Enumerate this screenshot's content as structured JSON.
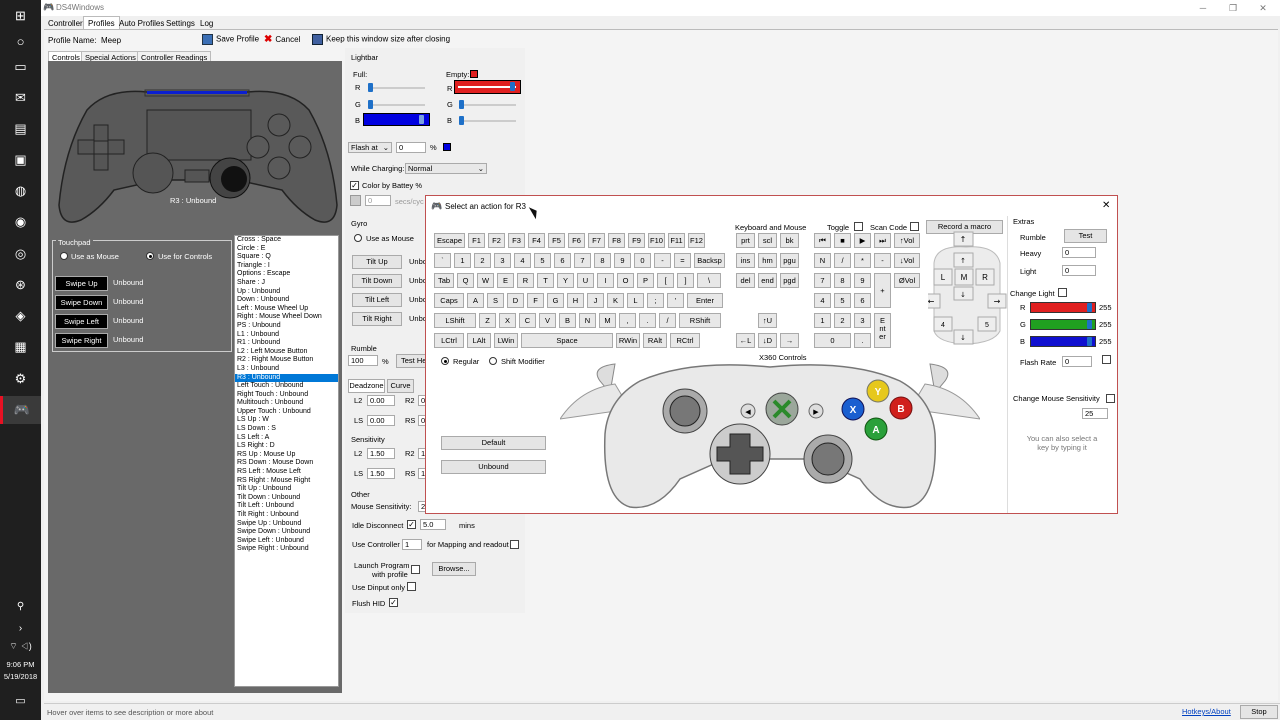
{
  "window": {
    "title": "DS4Windows"
  },
  "menu_tabs": [
    "Controllers",
    "Profiles",
    "Auto Profiles",
    "Settings",
    "Log"
  ],
  "toolbar": {
    "profile_name_label": "Profile Name:",
    "profile_name_value": "Meep",
    "save_label": "Save Profile",
    "cancel_label": "Cancel",
    "keep_size_label": "Keep this window size after closing"
  },
  "sub_tabs": [
    "Controls",
    "Special Actions",
    "Controller Readings"
  ],
  "controller": {
    "r3_caption": "R3 : Unbound"
  },
  "touchpad": {
    "group_label": "Touchpad",
    "use_as_mouse": "Use as Mouse",
    "use_for_controls": "Use for Controls",
    "swipes": [
      {
        "label": "Swipe Up",
        "value": "Unbound"
      },
      {
        "label": "Swipe Down",
        "value": "Unbound"
      },
      {
        "label": "Swipe Left",
        "value": "Unbound"
      },
      {
        "label": "Swipe Right",
        "value": "Unbound"
      }
    ]
  },
  "binding_list": [
    "Cross : Space",
    "Circle : E",
    "Square : Q",
    "Triangle : I",
    "Options : Escape",
    "Share : J",
    "Up : Unbound",
    "Down : Unbound",
    "Left : Mouse Wheel Up",
    "Right : Mouse Wheel Down",
    "PS : Unbound",
    "L1 : Unbound",
    "R1 : Unbound",
    "L2 : Left Mouse Button",
    "R2 : Right Mouse Button",
    "L3 : Unbound",
    "R3 : Unbound",
    "Left Touch : Unbound",
    "Right Touch : Unbound",
    "Multitouch : Unbound",
    "Upper Touch : Unbound",
    "LS Up : W",
    "LS Down : S",
    "LS Left : A",
    "LS Right : D",
    "RS Up : Mouse Up",
    "RS Down : Mouse Down",
    "RS Left : Mouse Left",
    "RS Right : Mouse Right",
    "Tilt Up : Unbound",
    "Tilt Down : Unbound",
    "Tilt Left : Unbound",
    "Tilt Right : Unbound",
    "Swipe Up : Unbound",
    "Swipe Down : Unbound",
    "Swipe Left : Unbound",
    "Swipe Right : Unbound"
  ],
  "binding_selected_index": 16,
  "lightbar": {
    "group_label": "Lightbar",
    "full_label": "Full:",
    "empty_label": "Empty:",
    "r": "R",
    "g": "G",
    "b": "B",
    "flash_mode": "Flash at",
    "flash_value": "0",
    "percent": "%",
    "while_charging_label": "While Charging:",
    "while_charging_value": "Normal",
    "color_by_battery": "Color by Battey %",
    "secs_value": "0",
    "secs_label": "secs/cyc"
  },
  "gyro": {
    "group_label": "Gyro",
    "use_as_mouse": "Use as Mouse",
    "tilts": [
      {
        "label": "Tilt Up",
        "value": "Unbo"
      },
      {
        "label": "Tilt Down",
        "value": "Unbo"
      },
      {
        "label": "Tilt Left",
        "value": "Unbo"
      },
      {
        "label": "Tilt Right",
        "value": "Unbo"
      }
    ]
  },
  "rumble": {
    "group_label": "Rumble",
    "value": "100",
    "percent": "%",
    "test_label": "Test He"
  },
  "deadzone": {
    "tabs": [
      "Deadzone",
      "Curve"
    ],
    "l2": "L2",
    "r2": "R2",
    "ls": "LS",
    "rs": "RS",
    "l2_value": "0.00",
    "ls_value": "0.00",
    "r2_value": "0.",
    "rs_value": "0."
  },
  "sensitivity": {
    "group_label": "Sensitivity",
    "l2": "L2",
    "r2": "R2",
    "ls": "LS",
    "rs": "RS",
    "l2_value": "1.50",
    "ls_value": "1.50",
    "r2_value": "1.",
    "rs_value": "1."
  },
  "other": {
    "group_label": "Other",
    "mouse_sensitivity": "Mouse Sensitivity:",
    "mouse_sensitivity_value": "2",
    "idle_disconnect": "Idle Disconnect",
    "idle_value": "5.0",
    "mins": "mins",
    "use_controller": "Use Controller",
    "use_controller_value": "1",
    "for_mapping": "for Mapping and readout",
    "launch_program_1": "Launch Program",
    "launch_program_2": "with profile",
    "browse": "Browse...",
    "use_dinput": "Use Dinput only",
    "flush_hid": "Flush HID"
  },
  "dialog": {
    "title": "Select an action for R3",
    "close": "✕",
    "kb_header": "Keyboard and Mouse",
    "toggle": "Toggle",
    "scan_code": "Scan Code",
    "record_macro": "Record a macro",
    "x360_label": "X360 Controls",
    "regular": "Regular",
    "shift_modifier": "Shift Modifier",
    "default_btn": "Default",
    "unbound_btn": "Unbound",
    "extras": {
      "header": "Extras",
      "rumble": "Rumble",
      "test": "Test",
      "heavy": "Heavy",
      "heavy_value": "0",
      "light": "Light",
      "light_value": "0",
      "change_light": "Change Light",
      "r": "R",
      "g": "G",
      "b": "B",
      "r_value": "255",
      "g_value": "255",
      "b_value": "255",
      "flash_rate": "Flash Rate",
      "flash_value": "0",
      "change_mouse": "Change Mouse Sensitivity",
      "mouse_value": "25",
      "hint": "You can also select a key by typing it"
    },
    "keys_row1": [
      "Escape",
      "F1",
      "F2",
      "F3",
      "F4",
      "F5",
      "F6",
      "F7",
      "F8",
      "F9",
      "F10",
      "F11",
      "F12"
    ],
    "keys_row2": [
      "`",
      "1",
      "2",
      "3",
      "4",
      "5",
      "6",
      "7",
      "8",
      "9",
      "0",
      "-",
      "=",
      "Backsp"
    ],
    "keys_row3": [
      "Tab",
      "Q",
      "W",
      "E",
      "R",
      "T",
      "Y",
      "U",
      "I",
      "O",
      "P",
      "[",
      "]",
      "\\"
    ],
    "keys_row4": [
      "Caps",
      "A",
      "S",
      "D",
      "F",
      "G",
      "H",
      "J",
      "K",
      "L",
      ";",
      "'",
      "Enter"
    ],
    "keys_row5": [
      "LShift",
      "Z",
      "X",
      "C",
      "V",
      "B",
      "N",
      "M",
      ",",
      ".",
      "/",
      "RShift"
    ],
    "keys_row6": [
      "LCtrl",
      "LAlt",
      "LWin",
      "Space",
      "RWin",
      "RAlt",
      "RCtrl"
    ],
    "nav_keys": [
      "prt",
      "scl",
      "bk",
      "ins",
      "hm",
      "pgu",
      "del",
      "end",
      "pgd"
    ],
    "arrow_keys": [
      "↑U",
      "←L",
      "↓D",
      "→"
    ],
    "media_keys": [
      "⏮",
      "■",
      "▶",
      "⏭",
      "↑Vol",
      "↓Vol",
      "ØVol"
    ],
    "media_symbols": [
      "◀",
      "▶"
    ],
    "numpad": [
      "N",
      "/",
      "*",
      "-",
      "7",
      "8",
      "9",
      "4",
      "5",
      "6",
      "+",
      "1",
      "2",
      "3",
      "0",
      ".",
      "E\nnt\ner"
    ],
    "mouse_keys": [
      "↑",
      "L",
      "M",
      "R",
      "↓",
      "↑",
      "←",
      "→",
      "↓",
      "4",
      "5",
      "↓"
    ],
    "xbox_buttons": {
      "y": "Y",
      "b": "B",
      "x": "X",
      "a": "A"
    }
  },
  "status": {
    "hint": "Hover over items to see description or more about",
    "hotkeys": "Hotkeys/About",
    "stop": "Stop"
  },
  "taskbar": {
    "time": "9:06 PM",
    "date": "5/19/2018"
  },
  "colors": {
    "accent": "#0078d7",
    "empty_red": "#e02020",
    "full_blue": "#0000e0",
    "dialog_border": "#c05050",
    "r_slider": "#e02020",
    "g_slider": "#20a020",
    "b_slider": "#1010d0"
  }
}
